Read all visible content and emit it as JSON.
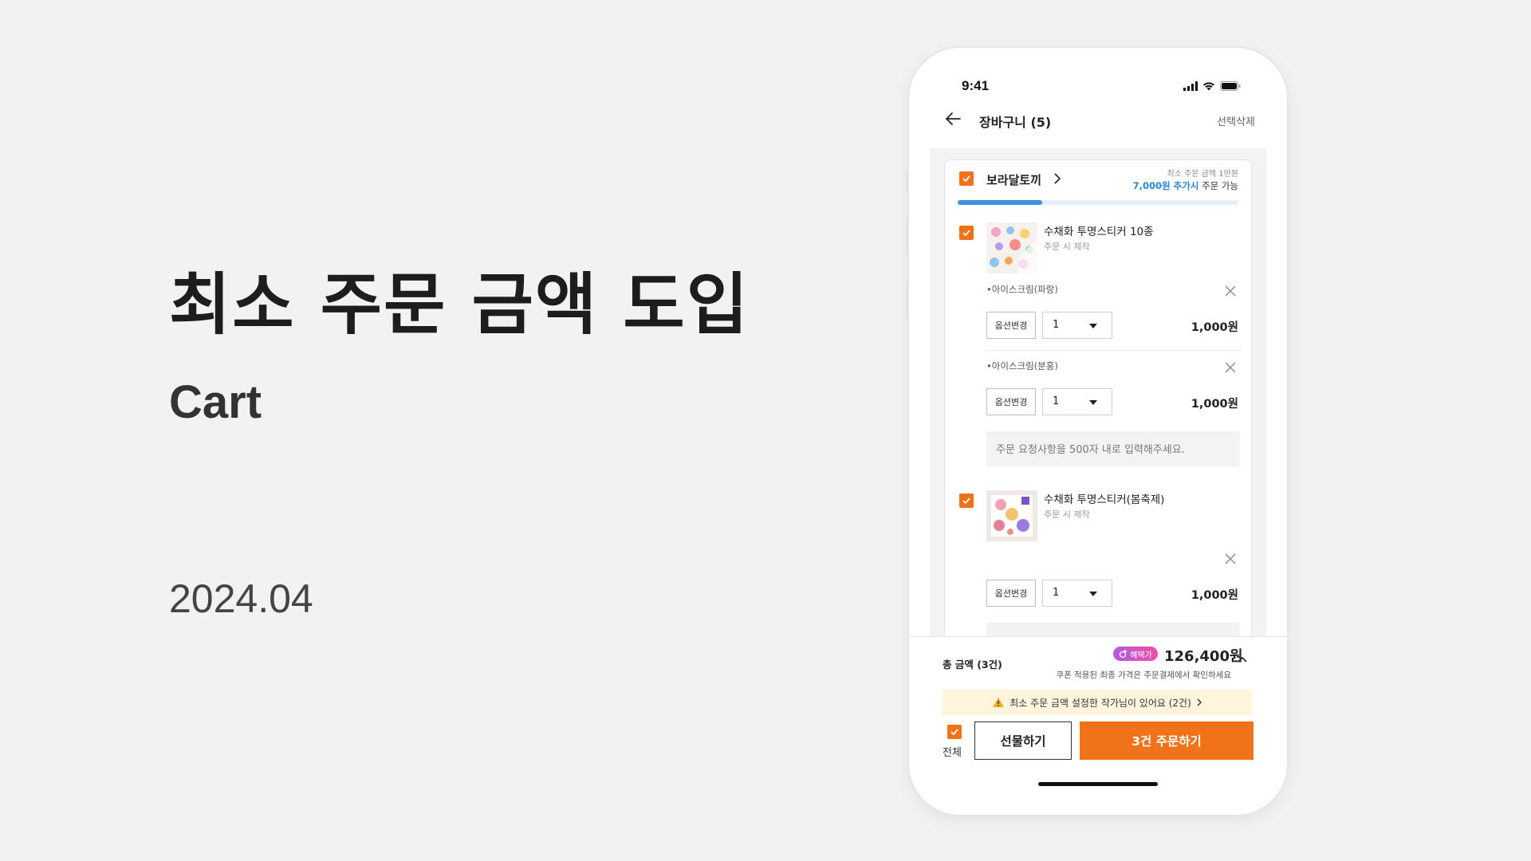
{
  "hero": {
    "title": "최소 주문 금액 도입",
    "subtitle": "Cart",
    "date": "2024.04"
  },
  "status_bar": {
    "time": "9:41"
  },
  "header": {
    "title": "장바구니 (5)",
    "action": "선택삭제"
  },
  "shop": {
    "name": "보라달토끼",
    "min_note": "최소 주문 금액 1만원",
    "min_highlight": "7,000원 추가시",
    "min_suffix": " 주문 가능",
    "progress": 0.3
  },
  "products": [
    {
      "name": "수채화 투명스티커 10종",
      "sub": "주문 시 제작",
      "options": [
        {
          "name": "•아이스크림(파랑)",
          "option_btn": "옵션변경",
          "qty": "1",
          "price": "1,000원"
        },
        {
          "name": "•아이스크림(분홍)",
          "option_btn": "옵션변경",
          "qty": "1",
          "price": "1,000원"
        }
      ],
      "memo_placeholder": "주문 요청사항을 500자 내로 입력해주세요."
    },
    {
      "name": "수채화 투명스티커(봄축제)",
      "sub": "주문 시 제작",
      "options": [
        {
          "name": "",
          "option_btn": "옵션변경",
          "qty": "1",
          "price": "1,000원"
        }
      ]
    }
  ],
  "summary": {
    "total_label": "총 금액 (3건)",
    "badge": "혜택가",
    "total_price": "126,400원",
    "note": "쿠폰 적용된 최종 가격은 주문결제에서 확인하세요",
    "warning": "최소 주문 금액 설정한 작가님이 있어요 (2건)",
    "all_label": "전체",
    "gift_button": "선물하기",
    "order_button": "3건 주문하기"
  },
  "colors": {
    "accent": "#f07219",
    "highlight_blue": "#2a86d6",
    "warning_bg": "#fff5dc",
    "background": "#f2f2f2"
  }
}
